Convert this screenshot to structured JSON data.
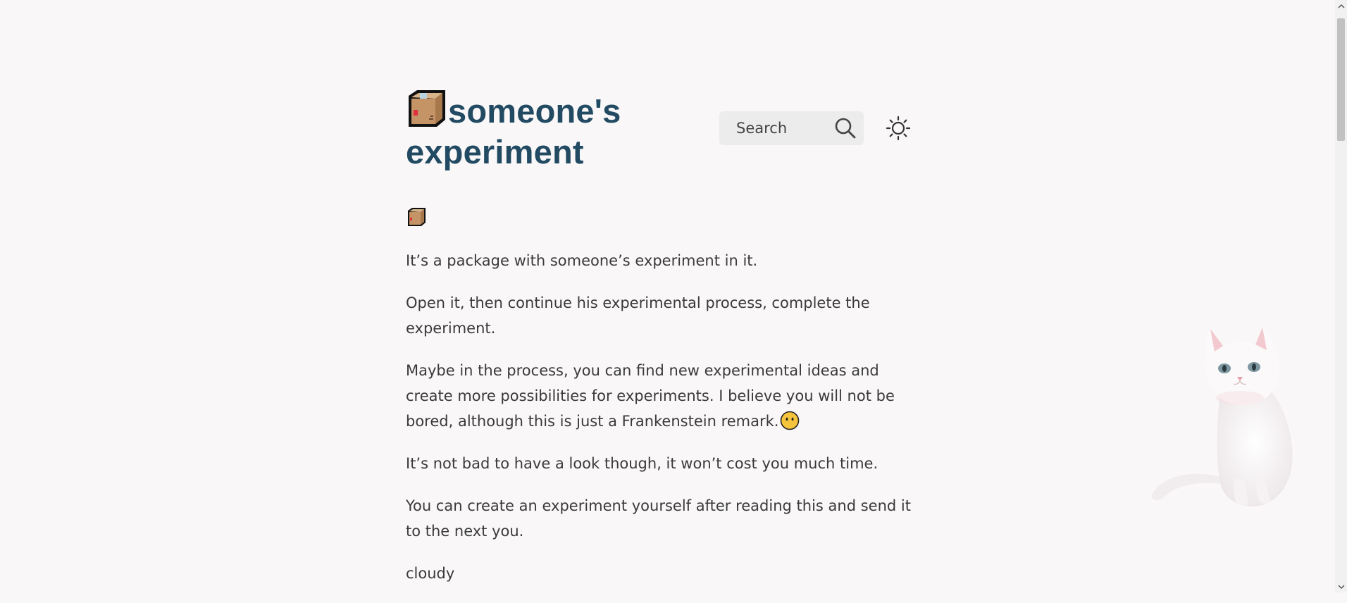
{
  "header": {
    "title": "someone's experiment",
    "title_icon": "package-box-icon",
    "search_label": "Search",
    "search_icon": "search-icon",
    "theme_icon": "sun-icon"
  },
  "content": {
    "top_icon": "package-box-icon",
    "paragraphs": [
      "It’s a package with someone’s experiment in it.",
      "Open it, then continue his experimental process, complete the experiment.",
      "Maybe in the process, you can find new experimental ideas and create more possibilities for experiments. I believe you will not be bored, although this is just a Frankenstein remark.",
      "It’s not bad to have a look though, it won’t cost you much time.",
      "You can create an experiment yourself after reading this and send it to the next you.",
      "cloudy"
    ],
    "inline_emoji": "no-mouth-face-icon"
  },
  "decoration": {
    "mascot": "white-cat-icon"
  },
  "colors": {
    "background": "#f9f7f7",
    "title": "#224b63",
    "text": "#3a3a3a",
    "search_bg": "#ececec"
  }
}
